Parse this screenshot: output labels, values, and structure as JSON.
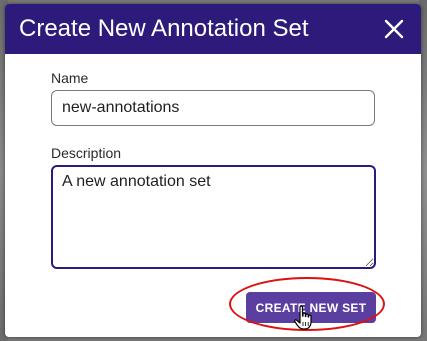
{
  "dialog": {
    "title": "Create New Annotation Set",
    "close_icon": "close-icon"
  },
  "form": {
    "name_label": "Name",
    "name_value": "new-annotations",
    "description_label": "Description",
    "description_value": "A new annotation set"
  },
  "actions": {
    "create_label": "CREATE NEW SET"
  },
  "colors": {
    "header": "#2e1a7a",
    "primary_button": "#5b3fa0",
    "highlight": "#e01010"
  },
  "overlay": {
    "cursor_icon": "hand-pointer-icon"
  }
}
